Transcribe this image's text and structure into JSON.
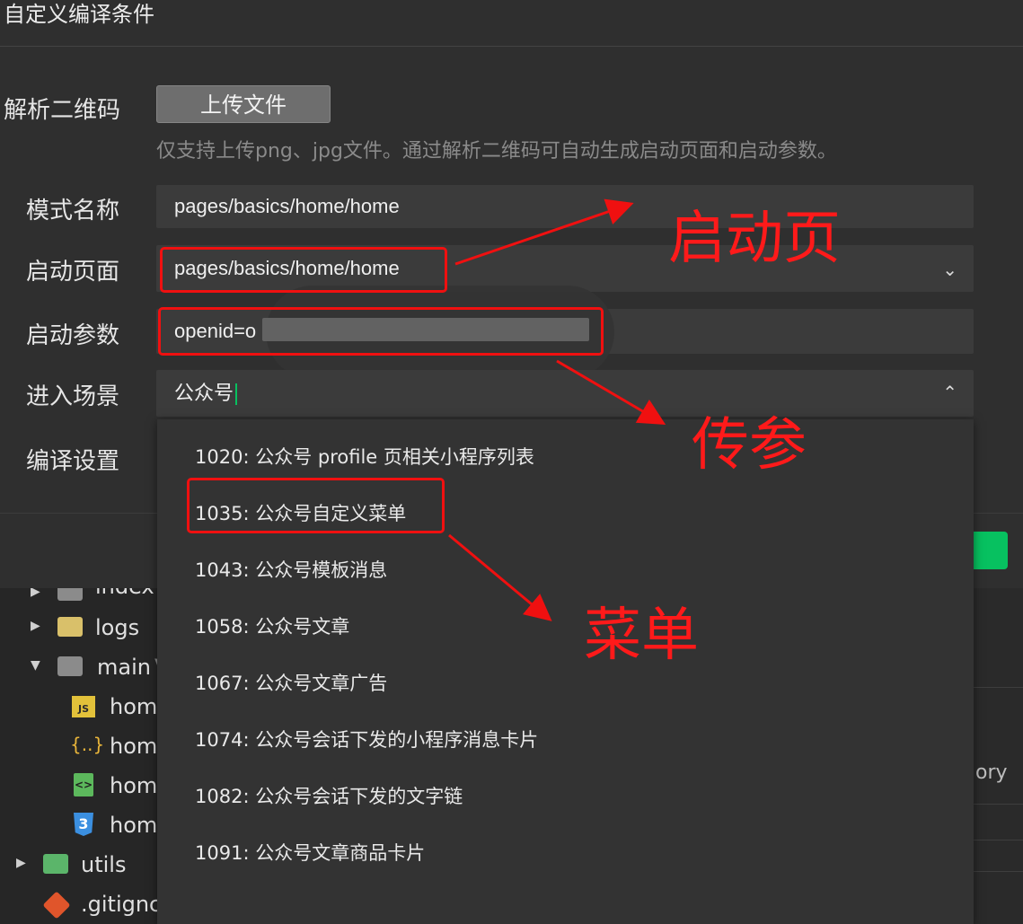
{
  "dialog": {
    "title": "自定义编译条件",
    "qr_label": "解析二维码",
    "upload_button": "上传文件",
    "upload_hint": "仅支持上传png、jpg文件。通过解析二维码可自动生成启动页面和启动参数。",
    "mode_name_label": "模式名称",
    "mode_name_value": "pages/basics/home/home",
    "start_page_label": "启动页面",
    "start_page_value": "pages/basics/home/home",
    "start_params_label": "启动参数",
    "start_params_value": "openid=o",
    "scene_label": "进入场景",
    "scene_value": "公众号",
    "compile_settings_label": "编译设置"
  },
  "dropdown_options": [
    "1020: 公众号 profile 页相关小程序列表",
    "1035: 公众号自定义菜单",
    "1043: 公众号模板消息",
    "1058: 公众号文章",
    "1067: 公众号文章广告",
    "1074: 公众号会话下发的小程序消息卡片",
    "1082: 公众号会话下发的文字链",
    "1091: 公众号文章商品卡片"
  ],
  "file_tree": {
    "items": [
      "index",
      "logs",
      "main",
      "hom",
      "hom",
      "hom",
      "hom",
      "utils",
      ".gitignc"
    ],
    "main_suffix": "V"
  },
  "right_panel": {
    "partial_text": "ory"
  },
  "annotations": {
    "start_page": "启动页",
    "pass_params": "传参",
    "menu": "菜单"
  },
  "colors": {
    "annotation_red": "#f01010",
    "accent_green": "#07c160"
  }
}
